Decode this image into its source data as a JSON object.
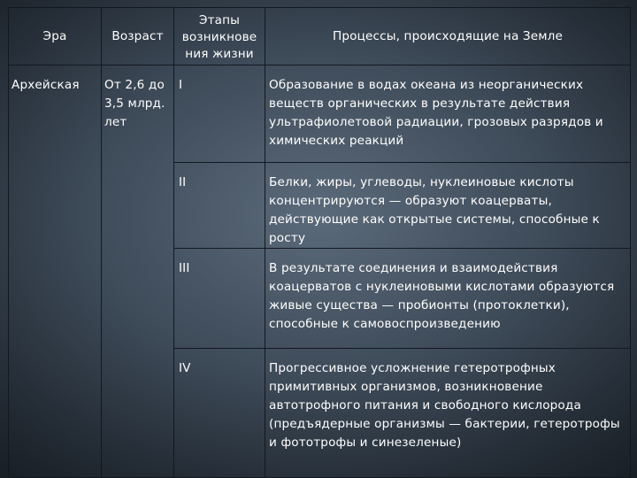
{
  "table": {
    "headers": {
      "era": "Эра",
      "age": "Возраст",
      "stage": "Этапы возникнове ния жизни",
      "processes": "Процессы, происходящие на Земле"
    },
    "era": "Архейская",
    "age": "От 2,6 до 3,5 млрд. лет",
    "rows": [
      {
        "stage": "I",
        "process": "Образование в водах океана из неорганических веществ органических в результате действия ультрафиолетовой радиации, грозовых разрядов и химических реакций"
      },
      {
        "stage": "II",
        "process": "Белки, жиры, углеводы, нуклеиновые кислоты концентрируются — образуют коацерваты, действующие как открытые системы, способные к росту"
      },
      {
        "stage": "III",
        "process": "В результате соединения и взаимодействия коацерватов с нуклеиновыми кислотами образуются живые существа — пробионты (протоклетки), способные к самовоспроизведению"
      },
      {
        "stage": "IV",
        "process": "Прогрессивное усложнение гетеротрофных примитивных организмов, возникновение автотрофного питания и свободного кислорода (предъядерные организмы — бактерии, гетеротрофы и фототрофы и синезеленые)"
      }
    ]
  }
}
